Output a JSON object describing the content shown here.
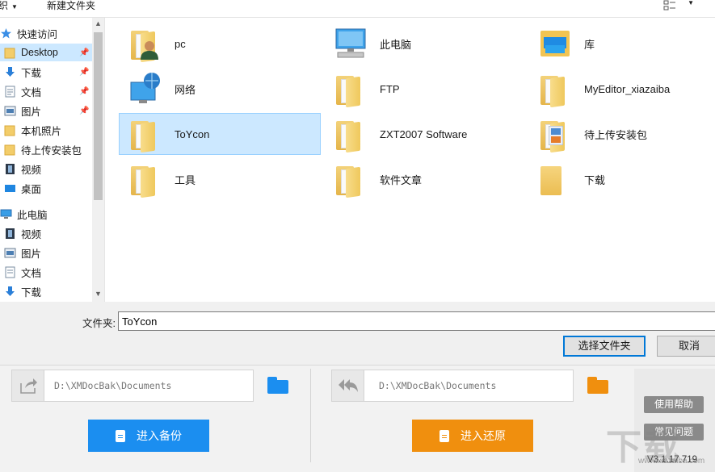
{
  "toolbar": {
    "organize_label": "组织",
    "new_folder_label": "新建文件夹"
  },
  "sidebar": {
    "items": [
      {
        "label": "快速访问",
        "icon": "star-icon"
      },
      {
        "label": "Desktop",
        "icon": "folder-icon",
        "pinned": true
      },
      {
        "label": "下载",
        "icon": "download-arrow-icon",
        "pinned": true
      },
      {
        "label": "文档",
        "icon": "document-icon",
        "pinned": true
      },
      {
        "label": "图片",
        "icon": "picture-icon",
        "pinned": true
      },
      {
        "label": "本机照片",
        "icon": "folder-icon"
      },
      {
        "label": "待上传安装包",
        "icon": "folder-icon"
      },
      {
        "label": "视频",
        "icon": "film-icon"
      },
      {
        "label": "桌面",
        "icon": "desktop-icon"
      },
      {
        "label": "此电脑",
        "icon": "computer-icon"
      },
      {
        "label": "视频",
        "icon": "film-icon"
      },
      {
        "label": "图片",
        "icon": "picture-icon"
      },
      {
        "label": "文档",
        "icon": "document-icon"
      },
      {
        "label": "下载",
        "icon": "download-arrow-icon"
      }
    ]
  },
  "files": [
    {
      "name": "pc",
      "icon": "user-folder-icon"
    },
    {
      "name": "此电脑",
      "icon": "computer-icon"
    },
    {
      "name": "库",
      "icon": "library-icon"
    },
    {
      "name": "网络",
      "icon": "network-icon"
    },
    {
      "name": "FTP",
      "icon": "folder-icon"
    },
    {
      "name": "MyEditor_xiazaiba",
      "icon": "folder-icon"
    },
    {
      "name": "ToYcon",
      "icon": "folder-icon"
    },
    {
      "name": "ZXT2007 Software",
      "icon": "folder-icon"
    },
    {
      "name": "待上传安装包",
      "icon": "folder-icon"
    },
    {
      "name": "工具",
      "icon": "folder-icon"
    },
    {
      "name": "软件文章",
      "icon": "folder-icon"
    },
    {
      "name": "下载",
      "icon": "folder-icon"
    }
  ],
  "folder_field": {
    "label": "文件夹:",
    "value": "ToYcon"
  },
  "dialog_buttons": {
    "select_label": "选择文件夹",
    "cancel_label": "取消"
  },
  "backup": {
    "path": "D:\\XMDocBak\\Documents",
    "button_label": "进入备份"
  },
  "restore": {
    "path": "D:\\XMDocBak\\Documents",
    "button_label": "进入还原"
  },
  "side_panel": {
    "help_label": "使用帮助",
    "faq_label": "常见问题",
    "version": "V3.1.17.719"
  },
  "watermark": {
    "big": "下载",
    "small": "www.xiazaiba.com"
  },
  "colors": {
    "selection": "#cce8ff",
    "backup_blue": "#1b8ef0",
    "restore_orange": "#f08f0e",
    "folder_gold": "#efc85c"
  }
}
